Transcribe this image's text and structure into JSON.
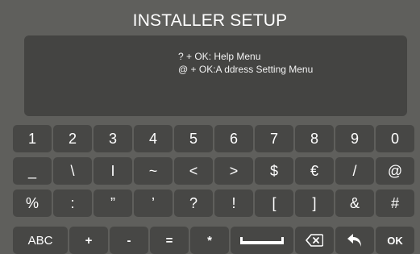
{
  "title": "INSTALLER SETUP",
  "display": {
    "line1": "? + OK: Help Menu",
    "line2": "@ + OK:A ddress Setting Menu"
  },
  "keyboard": {
    "row1": [
      "1",
      "2",
      "3",
      "4",
      "5",
      "6",
      "7",
      "8",
      "9",
      "0"
    ],
    "row2": [
      "_",
      "\\",
      "I",
      "~",
      "<",
      ">",
      "$",
      "€",
      "/",
      "@"
    ],
    "row3": [
      "%",
      ":",
      "”",
      "’",
      "?",
      "!",
      "[",
      "]",
      "&",
      "#"
    ],
    "row4": {
      "abc": "ABC",
      "plus": "+",
      "minus": "-",
      "equals": "=",
      "star": "*",
      "ok": "OK"
    }
  },
  "icons": {
    "space": "space-bar-icon",
    "backspace": "backspace-icon",
    "back": "back-arrow-icon"
  },
  "colors": {
    "background": "#5f5f5c",
    "panel": "#444442",
    "key": "#474745",
    "text": "#ffffff"
  }
}
